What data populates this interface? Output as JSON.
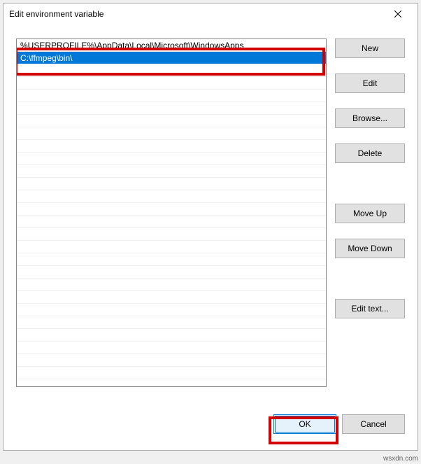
{
  "dialog": {
    "title": "Edit environment variable"
  },
  "list": {
    "rows": [
      {
        "text": "%USERPROFILE%\\AppData\\Local\\Microsoft\\WindowsApps",
        "selected": false
      },
      {
        "text": "C:\\ffmpeg\\bin\\",
        "selected": true
      }
    ]
  },
  "buttons": {
    "new": "New",
    "edit": "Edit",
    "browse": "Browse...",
    "delete": "Delete",
    "move_up": "Move Up",
    "move_down": "Move Down",
    "edit_text": "Edit text...",
    "ok": "OK",
    "cancel": "Cancel"
  },
  "watermark": "wsxdn.com",
  "highlights": {
    "color": "#d40000"
  }
}
